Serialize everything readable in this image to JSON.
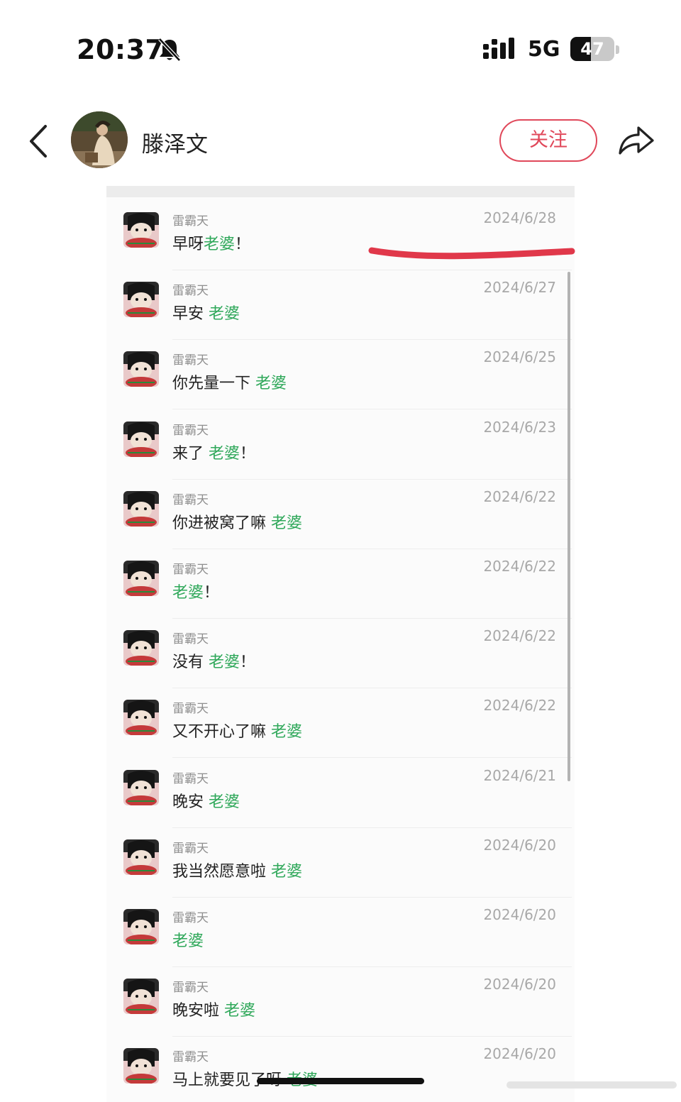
{
  "status_bar": {
    "time": "20:37",
    "network": "5G",
    "battery": "47",
    "battery_level": 0.47,
    "icons": [
      "bell-slash-icon",
      "signal-icon"
    ]
  },
  "header": {
    "name": "滕泽文",
    "follow_label": "关注",
    "icons": [
      "chevron-left-icon",
      "share-icon"
    ],
    "colors": {
      "follow": "#e0485a",
      "highlight": "#2fa85a"
    }
  },
  "messages": [
    {
      "sender": "雷霸天",
      "date": "2024/6/28",
      "text": "早呀",
      "highlight": "老婆",
      "suffix": "！"
    },
    {
      "sender": "雷霸天",
      "date": "2024/6/27",
      "text": "早安 ",
      "highlight": "老婆",
      "suffix": ""
    },
    {
      "sender": "雷霸天",
      "date": "2024/6/25",
      "text": "你先量一下 ",
      "highlight": "老婆",
      "suffix": ""
    },
    {
      "sender": "雷霸天",
      "date": "2024/6/23",
      "text": "来了 ",
      "highlight": "老婆",
      "suffix": "！"
    },
    {
      "sender": "雷霸天",
      "date": "2024/6/22",
      "text": "你进被窝了嘛 ",
      "highlight": "老婆",
      "suffix": ""
    },
    {
      "sender": "雷霸天",
      "date": "2024/6/22",
      "text": "",
      "highlight": "老婆",
      "suffix": "！"
    },
    {
      "sender": "雷霸天",
      "date": "2024/6/22",
      "text": "没有 ",
      "highlight": "老婆",
      "suffix": "！"
    },
    {
      "sender": "雷霸天",
      "date": "2024/6/22",
      "text": "又不开心了嘛 ",
      "highlight": "老婆",
      "suffix": ""
    },
    {
      "sender": "雷霸天",
      "date": "2024/6/21",
      "text": "晚安 ",
      "highlight": "老婆",
      "suffix": ""
    },
    {
      "sender": "雷霸天",
      "date": "2024/6/20",
      "text": "我当然愿意啦 ",
      "highlight": "老婆",
      "suffix": ""
    },
    {
      "sender": "雷霸天",
      "date": "2024/6/20",
      "text": "",
      "highlight": "老婆",
      "suffix": ""
    },
    {
      "sender": "雷霸天",
      "date": "2024/6/20",
      "text": "晚安啦 ",
      "highlight": "老婆",
      "suffix": ""
    },
    {
      "sender": "雷霸天",
      "date": "2024/6/20",
      "text": "马上就要见了呀 ",
      "highlight": "老婆",
      "suffix": ""
    }
  ]
}
